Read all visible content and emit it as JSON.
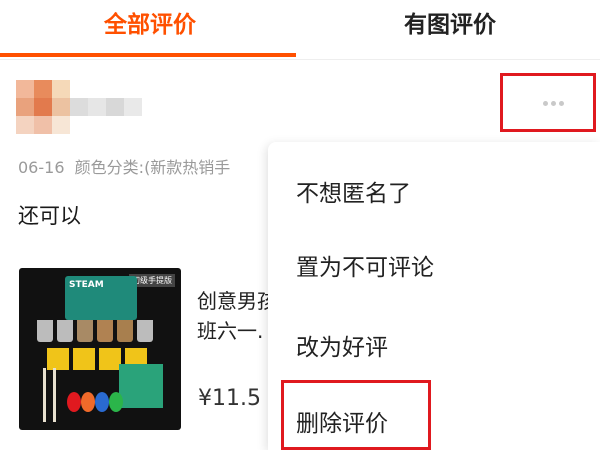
{
  "tabs": {
    "all": "全部评价",
    "with_images": "有图评价"
  },
  "review": {
    "date": "06-16",
    "variant": "颜色分类:(新款热销手",
    "text": "还可以"
  },
  "product": {
    "image_tag": "初级手提版",
    "box_label": "STEAM",
    "title": "创意男孩 班六一.",
    "price": "¥11.5"
  },
  "menu": {
    "items": [
      "不想匿名了",
      "置为不可评论",
      "改为好评",
      "删除评价"
    ]
  },
  "colors": {
    "accent": "#ff5000",
    "highlight": "#e0191f"
  }
}
